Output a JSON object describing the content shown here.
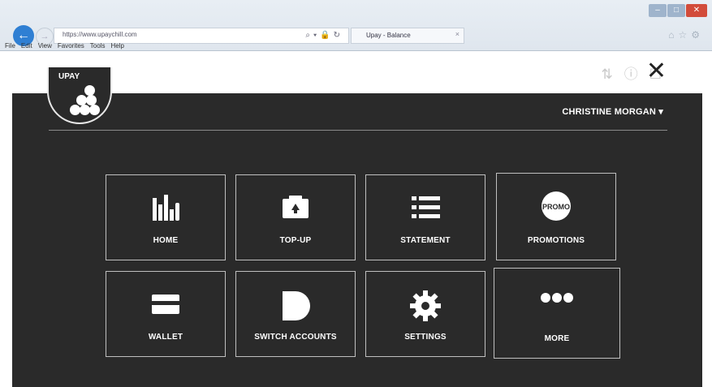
{
  "browser": {
    "url": "https://www.upaychill.com",
    "tab_title": "Upay - Balance",
    "tab_close": "×",
    "menu": [
      "File",
      "Edit",
      "View",
      "Favorites",
      "Tools",
      "Help"
    ],
    "back": "←",
    "forward": "→"
  },
  "app": {
    "logo_text": "UPAY",
    "user_name": "CHRISTINE MORGAN ▾",
    "close": "✕"
  },
  "tiles": [
    {
      "label": "HOME",
      "icon": "bar-chart-icon"
    },
    {
      "label": "TOP-UP",
      "icon": "top-up-icon"
    },
    {
      "label": "STATEMENT",
      "icon": "list-icon"
    },
    {
      "label": "PROMOTIONS",
      "icon": "promo-badge-icon",
      "badge": "PROMO"
    },
    {
      "label": "WALLET",
      "icon": "card-icon"
    },
    {
      "label": "SWITCH ACCOUNTS",
      "icon": "switch-icon"
    },
    {
      "label": "SETTINGS",
      "icon": "gear-icon"
    },
    {
      "label": "MORE",
      "icon": "more-dots-icon"
    }
  ],
  "colors": {
    "background": "#2a2a2a",
    "tile_border": "#bfbfbf",
    "text": "#ffffff"
  }
}
